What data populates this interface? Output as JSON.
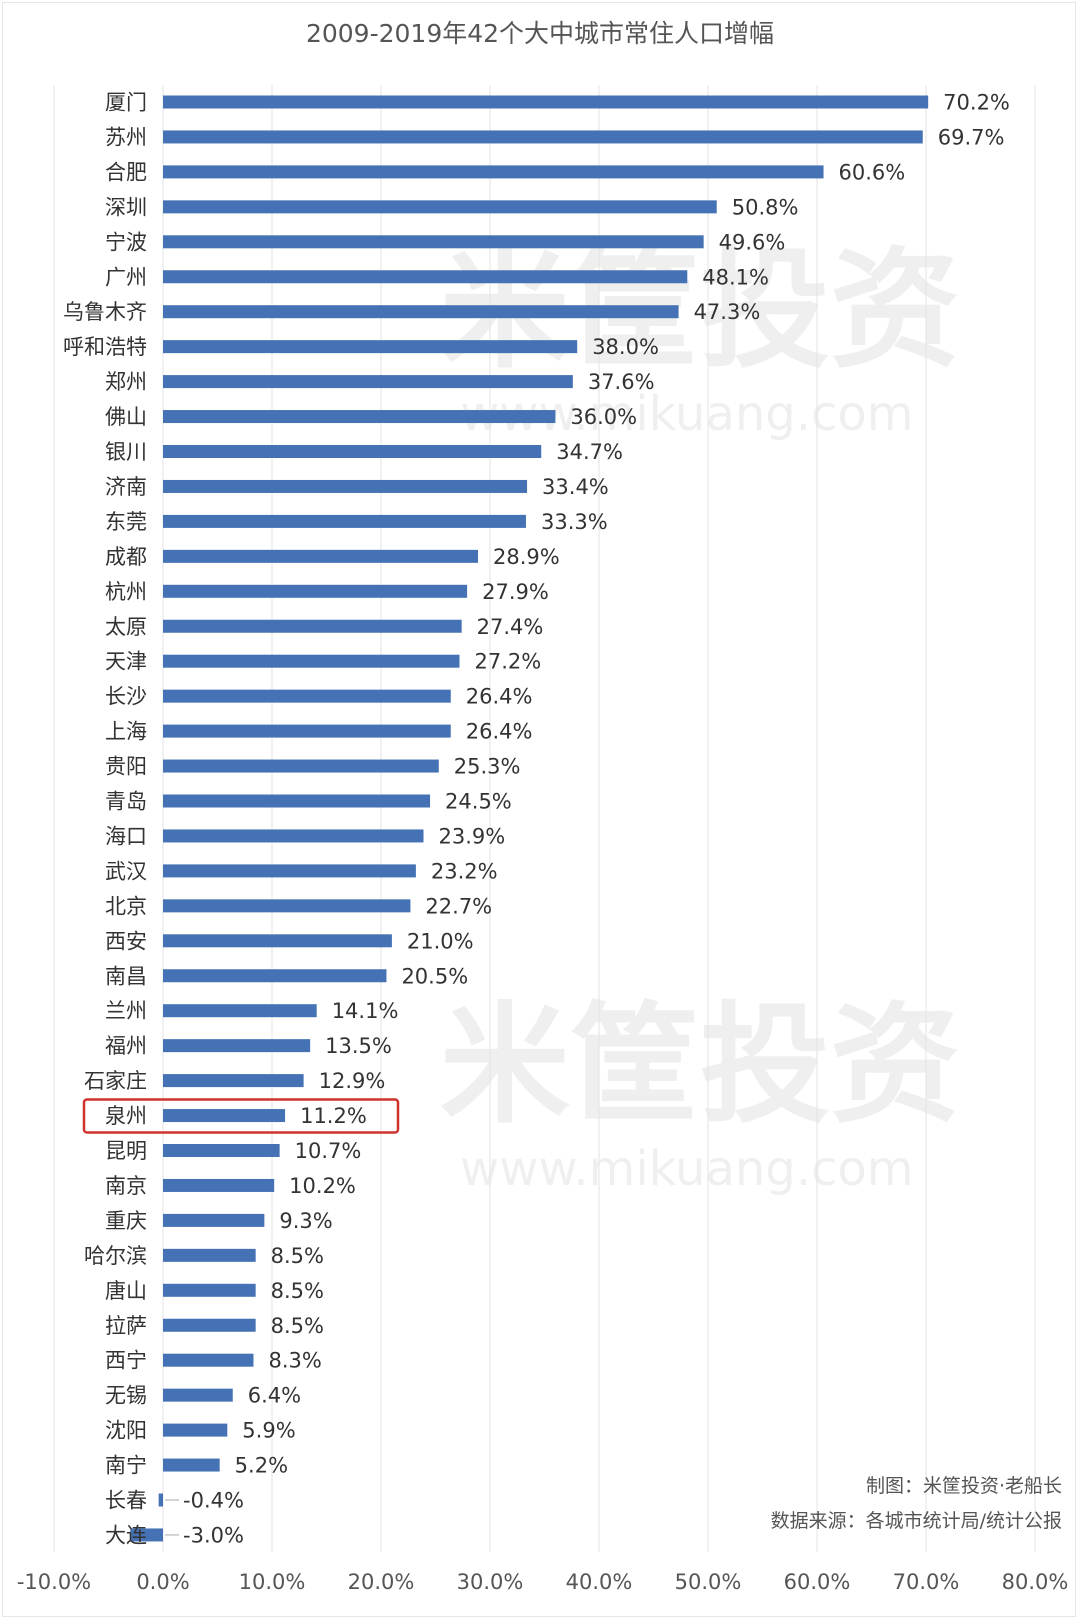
{
  "chart_data": {
    "type": "bar",
    "orientation": "horizontal",
    "title": "2009-2019年42个大中城市常住人口增幅",
    "xlabel": "",
    "ylabel": "",
    "xlim": [
      -10,
      80
    ],
    "x_ticks": [
      -10,
      0,
      10,
      20,
      30,
      40,
      50,
      60,
      70,
      80
    ],
    "x_tick_labels": [
      "-10.0%",
      "0.0%",
      "10.0%",
      "20.0%",
      "30.0%",
      "40.0%",
      "50.0%",
      "60.0%",
      "70.0%",
      "80.0%"
    ],
    "grid": true,
    "unit": "%",
    "bar_color": "#4472b4",
    "highlight_color": "#d0312d",
    "highlighted_category": "泉州",
    "categories": [
      "厦门",
      "苏州",
      "合肥",
      "深圳",
      "宁波",
      "广州",
      "乌鲁木齐",
      "呼和浩特",
      "郑州",
      "佛山",
      "银川",
      "济南",
      "东莞",
      "成都",
      "杭州",
      "太原",
      "天津",
      "长沙",
      "上海",
      "贵阳",
      "青岛",
      "海口",
      "武汉",
      "北京",
      "西安",
      "南昌",
      "兰州",
      "福州",
      "石家庄",
      "泉州",
      "昆明",
      "南京",
      "重庆",
      "哈尔滨",
      "唐山",
      "拉萨",
      "西宁",
      "无锡",
      "沈阳",
      "南宁",
      "长春",
      "大连"
    ],
    "values": [
      70.2,
      69.7,
      60.6,
      50.8,
      49.6,
      48.1,
      47.3,
      38.0,
      37.6,
      36.0,
      34.7,
      33.4,
      33.3,
      28.9,
      27.9,
      27.4,
      27.2,
      26.4,
      26.4,
      25.3,
      24.5,
      23.9,
      23.2,
      22.7,
      21.0,
      20.5,
      14.1,
      13.5,
      12.9,
      11.2,
      10.7,
      10.2,
      9.3,
      8.5,
      8.5,
      8.5,
      8.3,
      6.4,
      5.9,
      5.2,
      -0.4,
      -3.0
    ],
    "value_labels": [
      "70.2%",
      "69.7%",
      "60.6%",
      "50.8%",
      "49.6%",
      "48.1%",
      "47.3%",
      "38.0%",
      "37.6%",
      "36.0%",
      "34.7%",
      "33.4%",
      "33.3%",
      "28.9%",
      "27.9%",
      "27.4%",
      "27.2%",
      "26.4%",
      "26.4%",
      "25.3%",
      "24.5%",
      "23.9%",
      "23.2%",
      "22.7%",
      "21.0%",
      "20.5%",
      "14.1%",
      "13.5%",
      "12.9%",
      "11.2%",
      "10.7%",
      "10.2%",
      "9.3%",
      "8.5%",
      "8.5%",
      "8.5%",
      "8.3%",
      "6.4%",
      "5.9%",
      "5.2%",
      "-0.4%",
      "-3.0%"
    ],
    "annotations": {
      "credit": "制图：米筐投资·老船长",
      "source": "数据来源：各城市统计局/统计公报"
    },
    "watermark": {
      "text": "米筐投资",
      "url": "www.mikuang.com"
    }
  }
}
